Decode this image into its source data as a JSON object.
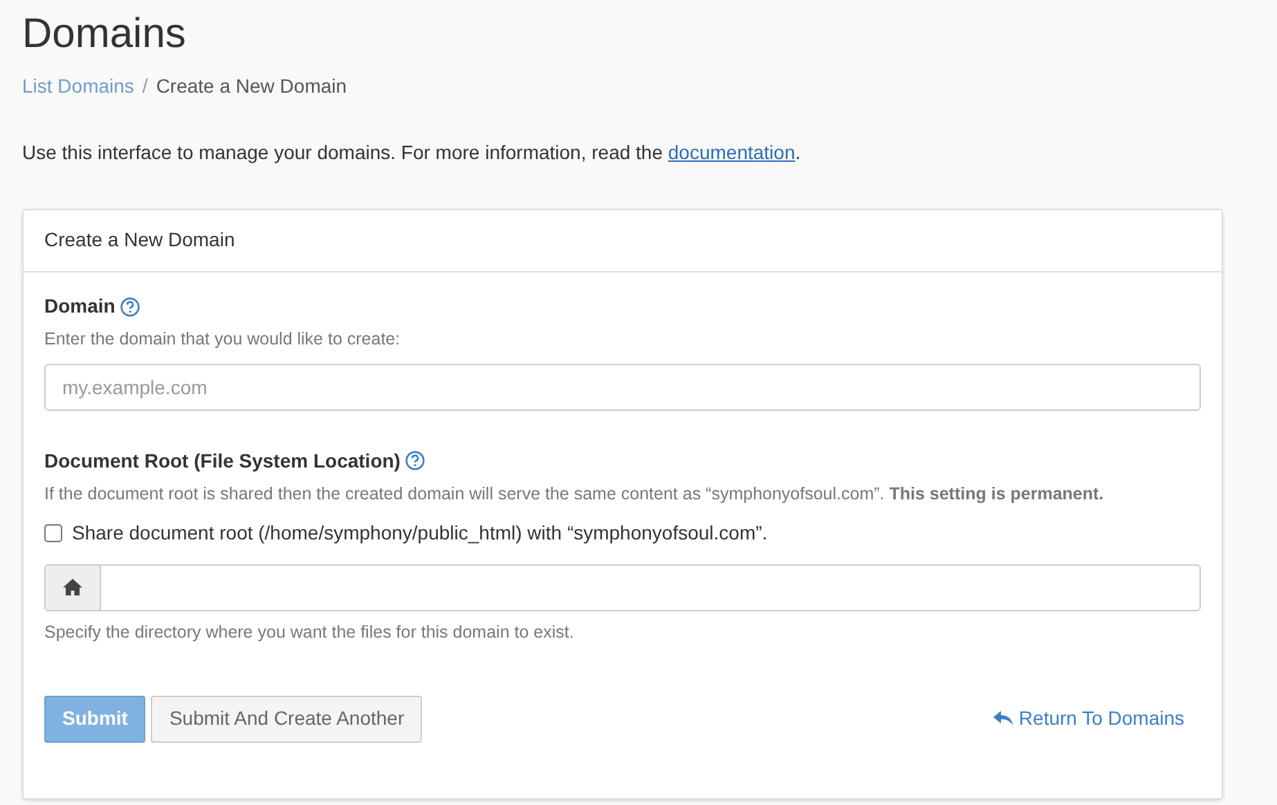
{
  "page_title": "Domains",
  "breadcrumb_separator": "/",
  "breadcrumb": [
    {
      "label": "List Domains",
      "link": true
    },
    {
      "label": "Create a New Domain",
      "link": false
    }
  ],
  "intro": {
    "before": "Use this interface to manage your domains. For more information, read the ",
    "link": "documentation",
    "after": "."
  },
  "panel": {
    "title": "Create a New Domain",
    "domain": {
      "label": "Domain",
      "help": "Enter the domain that you would like to create:",
      "placeholder": "my.example.com"
    },
    "docroot": {
      "label": "Document Root (File System Location)",
      "help": "If the document root is shared then the created domain will serve the same content as “symphonyofsoul.com”. **This setting is permanent.**",
      "share_label": "Share document root (/home/symphony/public_html) with “symphonyofsoul.com”.",
      "share_checked": false,
      "hint": "Specify the directory where you want the files for this domain to exist."
    },
    "buttons": [
      {
        "label": "Submit",
        "kind": "primary",
        "disabled": true
      },
      {
        "label": "Submit And Create Another",
        "kind": "default",
        "disabled": false
      }
    ],
    "return_link": "Return To Domains"
  }
}
